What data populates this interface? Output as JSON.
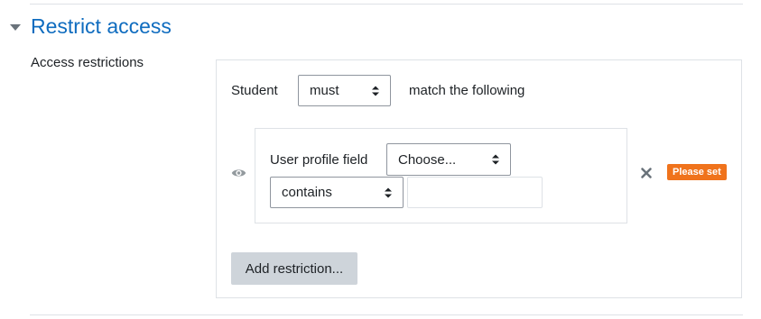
{
  "section": {
    "title": "Restrict access",
    "toggle_icon": "caret-down-icon"
  },
  "field": {
    "label": "Access restrictions"
  },
  "restrictions": {
    "subject_label": "Student",
    "match_select": {
      "selected": "must"
    },
    "match_suffix": "match the following",
    "condition": {
      "visibility_icon": "eye-icon",
      "type_label": "User profile field",
      "field_select": {
        "selected": "Choose..."
      },
      "operator_select": {
        "selected": "contains"
      },
      "value_input": {
        "value": ""
      },
      "delete_icon": "close-icon",
      "error_badge": "Please set"
    },
    "add_button_label": "Add restriction..."
  },
  "colors": {
    "accent": "#0f6cbf",
    "badge": "#f0731c",
    "button_bg": "#ced4da",
    "border": "#dee2e6"
  }
}
